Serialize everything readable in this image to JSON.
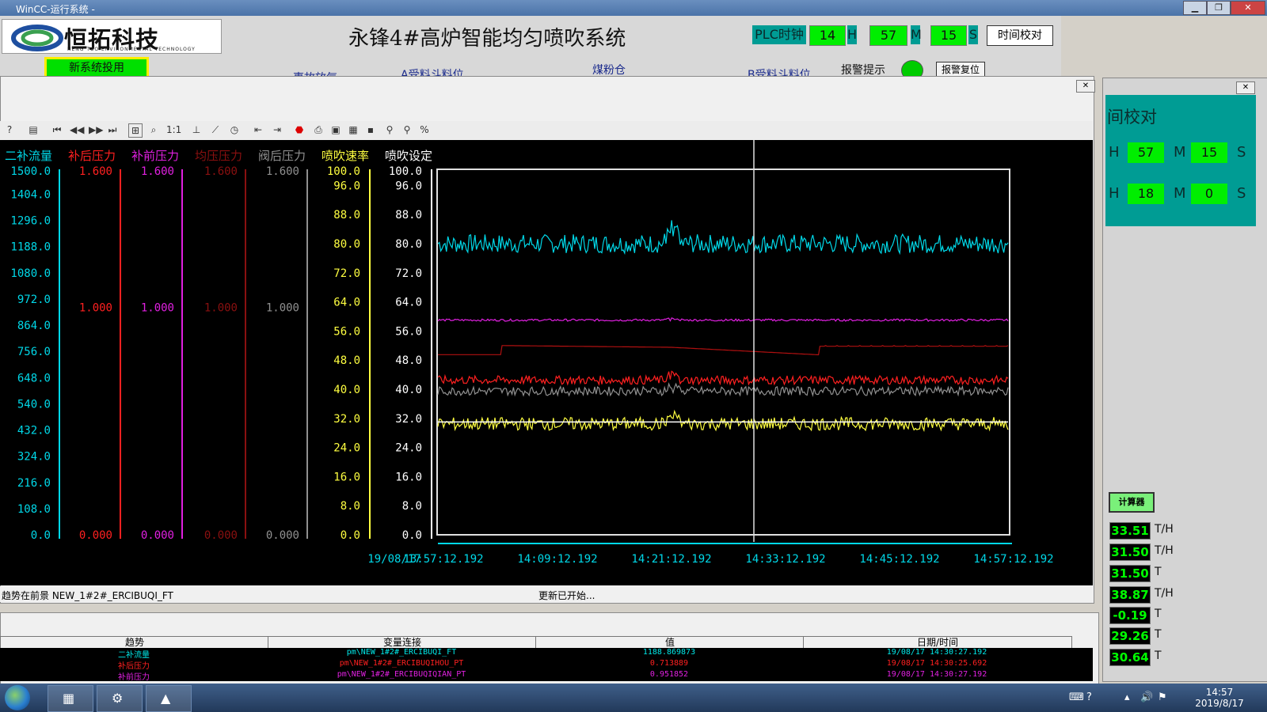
{
  "window": {
    "title": "WinCC-运行系统 -"
  },
  "header": {
    "logo_text": "恒拓科技",
    "logo_sub": "HENG TUO ENVIRONMENTAL TECHNOLOGY",
    "title": "永锋4#高炉智能均匀喷吹系统",
    "plc_label": "PLC时钟",
    "plc_h": "14",
    "h": "H",
    "plc_m": "57",
    "m": "M",
    "plc_s": "15",
    "s": "S",
    "time_calibrate": "时间校对",
    "new_system": "新系统投用",
    "nav": [
      "事故放气",
      "A受料斗料位",
      "煤粉仓",
      "B受料斗料位"
    ],
    "alarm_label": "报警提示",
    "alarm_reset": "报警复位"
  },
  "trend": {
    "legend": [
      {
        "label": "二补流量",
        "color": "#00d8e8"
      },
      {
        "label": "补后压力",
        "color": "#ff2020"
      },
      {
        "label": "补前压力",
        "color": "#e020e0"
      },
      {
        "label": "均压压力",
        "color": "#8a1010"
      },
      {
        "label": "阀后压力",
        "color": "#909090"
      },
      {
        "label": "喷吹速率",
        "color": "#ffff40"
      },
      {
        "label": "喷吹设定",
        "color": "#ffffff"
      }
    ],
    "axis_flow": [
      "1500.0",
      "1404.0",
      "1296.0",
      "1188.0",
      "1080.0",
      "972.0",
      "864.0",
      "756.0",
      "648.0",
      "540.0",
      "432.0",
      "324.0",
      "216.0",
      "108.0",
      "0.0"
    ],
    "axis_pressure": [
      "1.600",
      "1.000",
      "0.000"
    ],
    "axis_rate": [
      "100.0",
      "96.0",
      "88.0",
      "80.0",
      "72.0",
      "64.0",
      "56.0",
      "48.0",
      "40.0",
      "32.0",
      "24.0",
      "16.0",
      "8.0",
      "0.0"
    ],
    "time_axis": [
      "19/08/17",
      "13:57:12.192",
      "14:09:12.192",
      "14:21:12.192",
      "14:33:12.192",
      "14:45:12.192",
      "14:57:12.192"
    ],
    "status_left": "趋势在前景 NEW_1#2#_ERCIBUQI_FT",
    "status_right": "更新已开始..."
  },
  "chart_data": {
    "type": "line",
    "x_range": [
      "13:57:12.192",
      "14:57:12.192"
    ],
    "ylim": [
      0,
      100
    ],
    "series": [
      {
        "name": "二补流量",
        "color": "#00d8e8",
        "level": 80,
        "noise": 2.6
      },
      {
        "name": "补前压力",
        "color": "#e020e0",
        "level": 59,
        "noise": 0.3
      },
      {
        "name": "均压压力",
        "color": "#b01010",
        "level": 50,
        "noise": 0.2
      },
      {
        "name": "补后压力",
        "color": "#ff2020",
        "level": 42.5,
        "noise": 1.2
      },
      {
        "name": "阀后压力",
        "color": "#909090",
        "level": 39.5,
        "noise": 1.2
      },
      {
        "name": "喷吹速率",
        "color": "#ffff40",
        "level": 30.5,
        "noise": 1.8
      },
      {
        "name": "喷吹设定",
        "color": "#ffffff",
        "level": 31,
        "noise": 0
      }
    ]
  },
  "table": {
    "headers": [
      "趋势",
      "变量连接",
      "值",
      "日期/时间"
    ],
    "rows": [
      {
        "trend": "二补流量",
        "tag": "pm\\NEW_1#2#_ERCIBUQI_FT",
        "value": "1188.869873",
        "time": "19/08/17 14:30:27.192",
        "color": "#00e8e8"
      },
      {
        "trend": "补后压力",
        "tag": "pm\\NEW_1#2#_ERCIBUQIHOU_PT",
        "value": "0.713889",
        "time": "19/08/17 14:30:25.692",
        "color": "#ff2020"
      },
      {
        "trend": "补前压力",
        "tag": "pm\\NEW_1#2#_ERCIBUQIQIAN_PT",
        "value": "0.951852",
        "time": "19/08/17 14:30:27.192",
        "color": "#e020e0"
      }
    ]
  },
  "right_panel": {
    "title": "间校对",
    "h1": "57",
    "m1": "15",
    "h2": "18",
    "m2": "0",
    "calc_button": "计算器",
    "values": [
      {
        "v": "33.51",
        "unit": "T/H"
      },
      {
        "v": "31.50",
        "unit": "T/H"
      },
      {
        "v": "31.50",
        "unit": "T"
      },
      {
        "v": "38.87",
        "unit": "T/H"
      },
      {
        "v": "-0.19",
        "unit": "T"
      },
      {
        "v": "29.26",
        "unit": "T"
      },
      {
        "v": "30.64",
        "unit": "T"
      }
    ]
  },
  "taskbar": {
    "time": "14:57",
    "date": "2019/8/17"
  }
}
